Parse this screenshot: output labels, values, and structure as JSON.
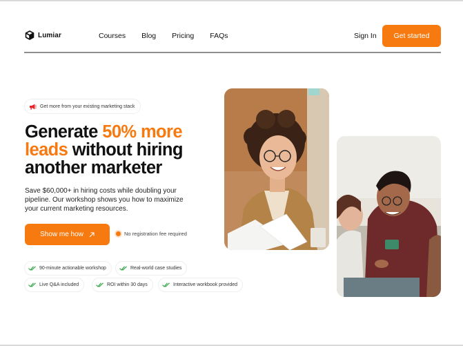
{
  "brand": {
    "name": "Lumiar",
    "logo_icon": "cube-logo-icon"
  },
  "nav": {
    "items": [
      {
        "label": "Courses"
      },
      {
        "label": "Blog"
      },
      {
        "label": "Pricing"
      },
      {
        "label": "FAQs"
      }
    ],
    "sign_in": "Sign In",
    "get_started": "Get started"
  },
  "hero": {
    "pill": {
      "icon": "megaphone-icon",
      "text": "Get more from your existing marketing stack"
    },
    "headline": {
      "part1": "Generate ",
      "accent": "50% more leads",
      "part2": " without hiring another marketer"
    },
    "subtext": "Save $60,000+ in hiring costs while doubling your pipeline. Our workshop shows you how to maximize your current marketing resources.",
    "cta": {
      "label": "Show me how",
      "icon": "arrow-up-right-icon"
    },
    "note": "No registration fee required",
    "features": [
      "90-minute actionable workshop",
      "Real-world case studies",
      "Live Q&A included",
      "ROI within 30 days",
      "Interactive workbook provided"
    ]
  },
  "colors": {
    "accent": "#f77a10",
    "text": "#111111",
    "check": "#3aa64a"
  }
}
